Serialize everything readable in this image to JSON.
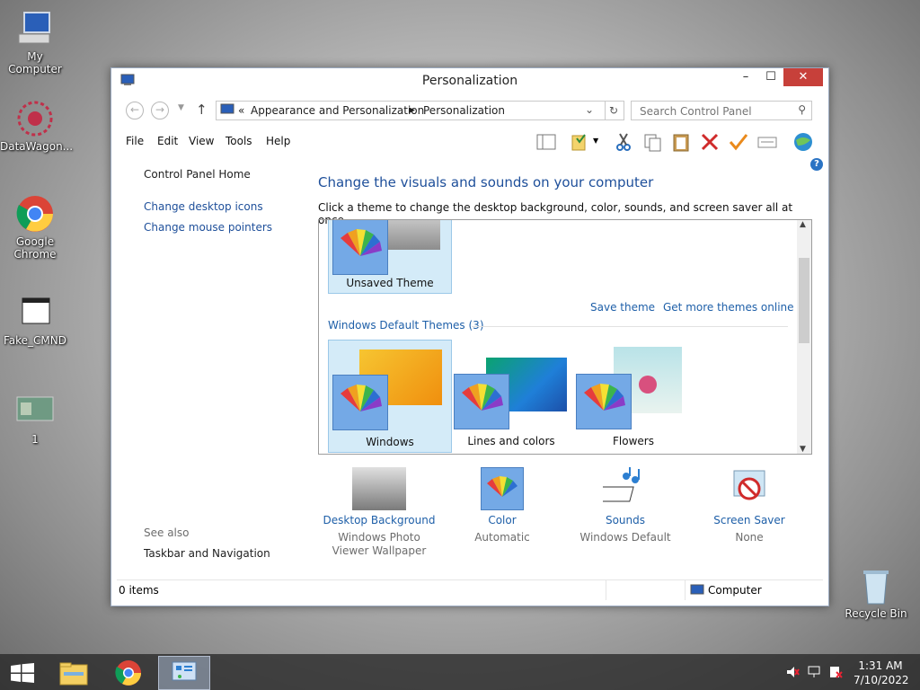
{
  "desktop": {
    "icons": [
      {
        "label": "My Computer"
      },
      {
        "label": "DataWagon..."
      },
      {
        "label": "Google Chrome"
      },
      {
        "label": "Fake_CMND"
      },
      {
        "label": "1"
      },
      {
        "label": "Recycle Bin"
      }
    ]
  },
  "window": {
    "title": "Personalization",
    "controls": {
      "minimize": "–",
      "maximize": "☐",
      "close": "✕"
    },
    "address": {
      "prefix": "«",
      "crumbs": [
        "Appearance and Personalization",
        "Personalization"
      ],
      "search_placeholder": "Search Control Panel"
    },
    "menu": [
      "File",
      "Edit",
      "View",
      "Tools",
      "Help"
    ],
    "help_icon": "?",
    "left": {
      "home": "Control Panel Home",
      "links": [
        "Change desktop icons",
        "Change mouse pointers"
      ],
      "see_also_title": "See also",
      "see_also": [
        "Taskbar and Navigation"
      ]
    },
    "main": {
      "heading": "Change the visuals and sounds on your computer",
      "subtitle": "Click a theme to change the desktop background, color, sounds, and screen saver all at once.",
      "unsaved_theme": "Unsaved Theme",
      "save_theme": "Save theme",
      "get_more": "Get more themes online",
      "default_group": "Windows Default Themes (3)",
      "themes": [
        "Windows",
        "Lines and colors",
        "Flowers"
      ]
    },
    "bottom": [
      {
        "label": "Desktop Background",
        "value": "Windows Photo Viewer Wallpaper"
      },
      {
        "label": "Color",
        "value": "Automatic"
      },
      {
        "label": "Sounds",
        "value": "Windows Default"
      },
      {
        "label": "Screen Saver",
        "value": "None"
      }
    ],
    "status": {
      "items": "0 items",
      "location": "Computer"
    }
  },
  "taskbar": {
    "time": "1:31 AM",
    "date": "7/10/2022"
  },
  "colors": {
    "accent": "#1e5fa8",
    "close": "#c7403a",
    "selected": "#d4ebf8"
  }
}
